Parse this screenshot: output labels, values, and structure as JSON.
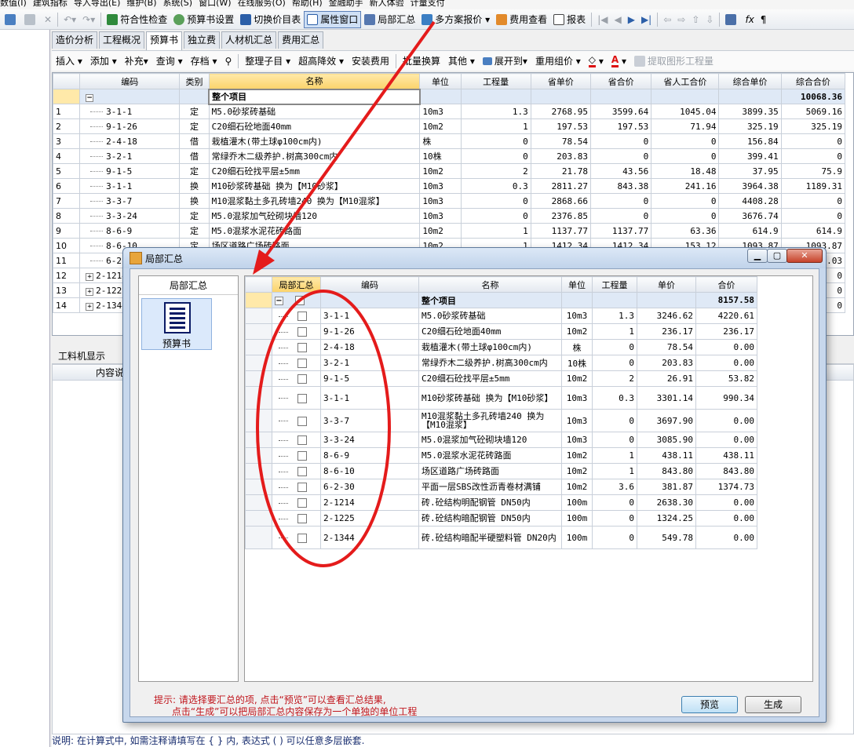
{
  "menubar": [
    "数值(I)",
    "建筑指标",
    "导入导出(E)",
    "维护(B)",
    "系统(S)",
    "窗口(W)",
    "在线服务(O)",
    "帮助(H)",
    "金融助手",
    "新人体验",
    "计量支付"
  ],
  "toolbar1": {
    "items": [
      "符合性检查",
      "预算书设置",
      "切换价目表",
      "属性窗口",
      "局部汇总",
      "多方案报价",
      "费用查看",
      "报表"
    ]
  },
  "tabs": [
    "造价分析",
    "工程概况",
    "预算书",
    "独立费",
    "人材机汇总",
    "费用汇总"
  ],
  "active_tab": "预算书",
  "toolbar2": [
    "插入",
    "添加",
    "补充",
    "查询",
    "存档",
    "整理子目",
    "超高降效",
    "安装费用",
    "批量换算",
    "其他",
    "展开到",
    "重用组价",
    "提取图形工程量"
  ],
  "main_grid": {
    "headers": [
      "编码",
      "类别",
      "名称",
      "单位",
      "工程量",
      "省单价",
      "省合价",
      "省人工合价",
      "综合单价",
      "综合合价"
    ],
    "total": {
      "name": "整个项目",
      "amount": "10068.36"
    },
    "rows": [
      {
        "no": "1",
        "code": "3-1-1",
        "type": "定",
        "name": "M5.0砂浆砖基础",
        "unit": "10m3",
        "qty": "1.3",
        "sp": "2768.95",
        "st": "3599.64",
        "lt": "1045.04",
        "cp": "3899.35",
        "ct": "5069.16"
      },
      {
        "no": "2",
        "code": "9-1-26",
        "type": "定",
        "name": "C20细石砼地面40mm",
        "unit": "10m2",
        "qty": "1",
        "sp": "197.53",
        "st": "197.53",
        "lt": "71.94",
        "cp": "325.19",
        "ct": "325.19"
      },
      {
        "no": "3",
        "code": "2-4-18",
        "type": "借",
        "name": "栽植灌木(带土球φ100cm内)",
        "unit": "株",
        "qty": "0",
        "sp": "78.54",
        "st": "0",
        "lt": "0",
        "cp": "156.84",
        "ct": "0"
      },
      {
        "no": "4",
        "code": "3-2-1",
        "type": "借",
        "name": "常绿乔木二级养护.树高300cm内",
        "unit": "10株",
        "qty": "0",
        "sp": "203.83",
        "st": "0",
        "lt": "0",
        "cp": "399.41",
        "ct": "0"
      },
      {
        "no": "5",
        "code": "9-1-5",
        "type": "定",
        "name": "C20细石砼找平层±5mm",
        "unit": "10m2",
        "qty": "2",
        "sp": "21.78",
        "st": "43.56",
        "lt": "18.48",
        "cp": "37.95",
        "ct": "75.9"
      },
      {
        "no": "6",
        "code": "3-1-1",
        "type": "换",
        "name": "M10砂浆砖基础 换为【M10砂浆】",
        "unit": "10m3",
        "qty": "0.3",
        "sp": "2811.27",
        "st": "843.38",
        "lt": "241.16",
        "cp": "3964.38",
        "ct": "1189.31"
      },
      {
        "no": "7",
        "code": "3-3-7",
        "type": "换",
        "name": "M10混浆黏土多孔砖墙240 换为【M10混浆】",
        "unit": "10m3",
        "qty": "0",
        "sp": "2868.66",
        "st": "0",
        "lt": "0",
        "cp": "4408.28",
        "ct": "0"
      },
      {
        "no": "8",
        "code": "3-3-24",
        "type": "定",
        "name": "M5.0混浆加气砼砌块墙120",
        "unit": "10m3",
        "qty": "0",
        "sp": "2376.85",
        "st": "0",
        "lt": "0",
        "cp": "3676.74",
        "ct": "0"
      },
      {
        "no": "9",
        "code": "8-6-9",
        "type": "定",
        "name": "M5.0混浆水泥花砖路面",
        "unit": "10m2",
        "qty": "1",
        "sp": "1137.77",
        "st": "1137.77",
        "lt": "63.36",
        "cp": "614.9",
        "ct": "614.9"
      },
      {
        "no": "10",
        "code": "8-6-10",
        "type": "定",
        "name": "场区道路广场砖路面",
        "unit": "10m2",
        "qty": "1",
        "sp": "1412.34",
        "st": "1412.34",
        "lt": "153.12",
        "cp": "1093.87",
        "ct": "1093.87"
      },
      {
        "no": "11",
        "code": "6-2-30",
        "type": "定",
        "name": "",
        "unit": "",
        "qty": "",
        "sp": "",
        "st": "",
        "lt": "",
        "cp": "",
        "ct": "1374.03"
      },
      {
        "no": "12",
        "code": "2-1214",
        "type": "",
        "name": "",
        "unit": "",
        "qty": "",
        "sp": "",
        "st": "",
        "lt": "",
        "cp": "",
        "ct": "0"
      },
      {
        "no": "13",
        "code": "2-1225",
        "type": "",
        "name": "",
        "unit": "",
        "qty": "",
        "sp": "",
        "st": "",
        "lt": "",
        "cp": "",
        "ct": "0"
      },
      {
        "no": "14",
        "code": "2-1344",
        "type": "",
        "name": "",
        "unit": "",
        "qty": "",
        "sp": "",
        "st": "",
        "lt": "",
        "cp": "",
        "ct": "0"
      }
    ]
  },
  "lower": {
    "tab": "工料机显示",
    "col": "内容说明"
  },
  "statusbar": "说明: 在计算式中, 如需注释请填写在 { } 内, 表达式 ( ) 可以任意多层嵌套.",
  "dialog": {
    "title": "局部汇总",
    "left_header": "局部汇总",
    "left_item": "预算书",
    "headers": [
      "局部汇总",
      "编码",
      "名称",
      "单位",
      "工程量",
      "单价",
      "合价"
    ],
    "total": {
      "name": "整个项目",
      "amount": "8157.58"
    },
    "rows": [
      {
        "code": "3-1-1",
        "name": "M5.0砂浆砖基础",
        "unit": "10m3",
        "qty": "1.3",
        "price": "3246.62",
        "total": "4220.61"
      },
      {
        "code": "9-1-26",
        "name": "C20细石砼地面40mm",
        "unit": "10m2",
        "qty": "1",
        "price": "236.17",
        "total": "236.17"
      },
      {
        "code": "2-4-18",
        "name": "栽植灌木(带土球φ100cm内)",
        "unit": "株",
        "qty": "0",
        "price": "78.54",
        "total": "0.00"
      },
      {
        "code": "3-2-1",
        "name": "常绿乔木二级养护.树高300cm内",
        "unit": "10株",
        "qty": "0",
        "price": "203.83",
        "total": "0.00"
      },
      {
        "code": "9-1-5",
        "name": "C20细石砼找平层±5mm",
        "unit": "10m2",
        "qty": "2",
        "price": "26.91",
        "total": "53.82"
      },
      {
        "code": "3-1-1",
        "name": "M10砂浆砖基础 换为【M10砂浆】",
        "unit": "10m3",
        "qty": "0.3",
        "price": "3301.14",
        "total": "990.34",
        "tall": true
      },
      {
        "code": "3-3-7",
        "name": "M10混浆黏土多孔砖墙240 换为【M10混浆】",
        "unit": "10m3",
        "qty": "0",
        "price": "3697.90",
        "total": "0.00",
        "tall": true
      },
      {
        "code": "3-3-24",
        "name": "M5.0混浆加气砼砌块墙120",
        "unit": "10m3",
        "qty": "0",
        "price": "3085.90",
        "total": "0.00"
      },
      {
        "code": "8-6-9",
        "name": "M5.0混浆水泥花砖路面",
        "unit": "10m2",
        "qty": "1",
        "price": "438.11",
        "total": "438.11"
      },
      {
        "code": "8-6-10",
        "name": "场区道路广场砖路面",
        "unit": "10m2",
        "qty": "1",
        "price": "843.80",
        "total": "843.80"
      },
      {
        "code": "6-2-30",
        "name": "平面一层SBS改性沥青卷材满铺",
        "unit": "10m2",
        "qty": "3.6",
        "price": "381.87",
        "total": "1374.73"
      },
      {
        "code": "2-1214",
        "name": "砖.砼结构明配钢管 DN50内",
        "unit": "100m",
        "qty": "0",
        "price": "2638.30",
        "total": "0.00"
      },
      {
        "code": "2-1225",
        "name": "砖.砼结构暗配钢管 DN50内",
        "unit": "100m",
        "qty": "0",
        "price": "1324.25",
        "total": "0.00"
      },
      {
        "code": "2-1344",
        "name": "砖.砼结构暗配半硬塑料管 DN20内",
        "unit": "100m",
        "qty": "0",
        "price": "549.78",
        "total": "0.00",
        "tall": true
      }
    ],
    "hint_line1": "提示: 请选择要汇总的项, 点击“预览”可以查看汇总结果,",
    "hint_line2": "      点击“生成”可以把局部汇总内容保存为一个单独的单位工程",
    "btn_preview": "预览",
    "btn_generate": "生成"
  },
  "colors": {
    "accent": "#cfe0f5",
    "annotation": "#e41b1b",
    "hint": "#c0141b"
  }
}
